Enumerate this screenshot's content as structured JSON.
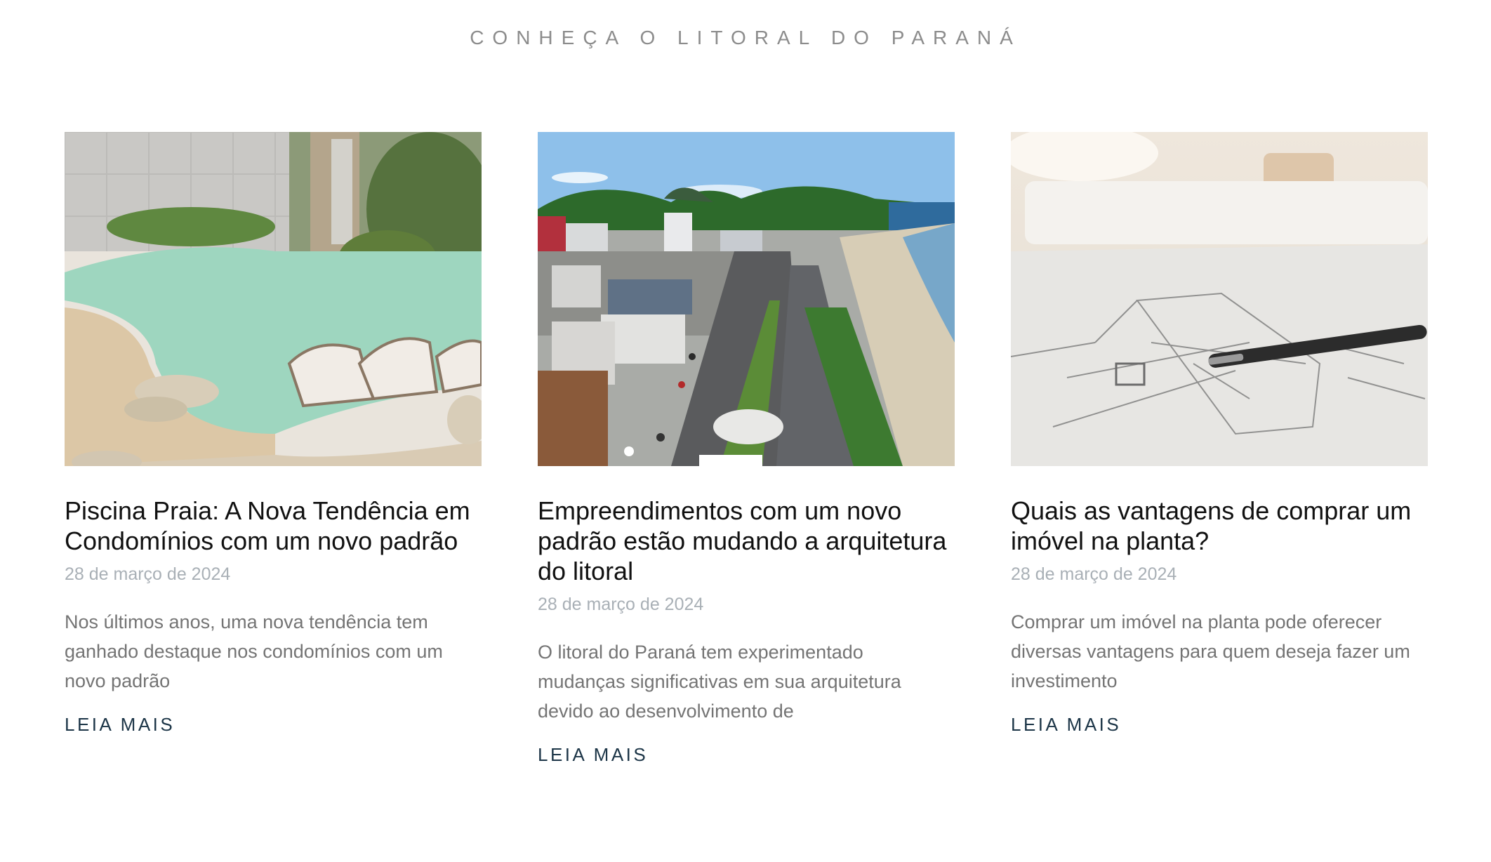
{
  "section": {
    "title": "CONHEÇA O LITORAL DO PARANÁ"
  },
  "posts": [
    {
      "image_name": "beach-pool-image",
      "title": "Piscina Praia: A Nova Tendência em Condomínios com um novo padrão",
      "date": "28 de março de 2024",
      "excerpt": "Nos últimos anos, uma nova tendência tem ganhado destaque nos condomínios com um novo padrão",
      "link_label": "LEIA MAIS"
    },
    {
      "image_name": "coastal-city-image",
      "title": "Empreendimentos com um novo padrão estão mudando a arquitetura do litoral",
      "date": "28 de março de 2024",
      "excerpt": "O litoral do Paraná tem experimentado mudanças significativas em sua arquitetura devido ao desenvolvimento de",
      "link_label": "LEIA MAIS"
    },
    {
      "image_name": "floor-plan-image",
      "title": "Quais as vantagens de comprar um imóvel na planta?",
      "date": "28 de março de 2024",
      "excerpt": "Comprar um imóvel na planta pode oferecer diversas vantagens para quem deseja fazer um investimento",
      "link_label": "LEIA MAIS"
    }
  ]
}
